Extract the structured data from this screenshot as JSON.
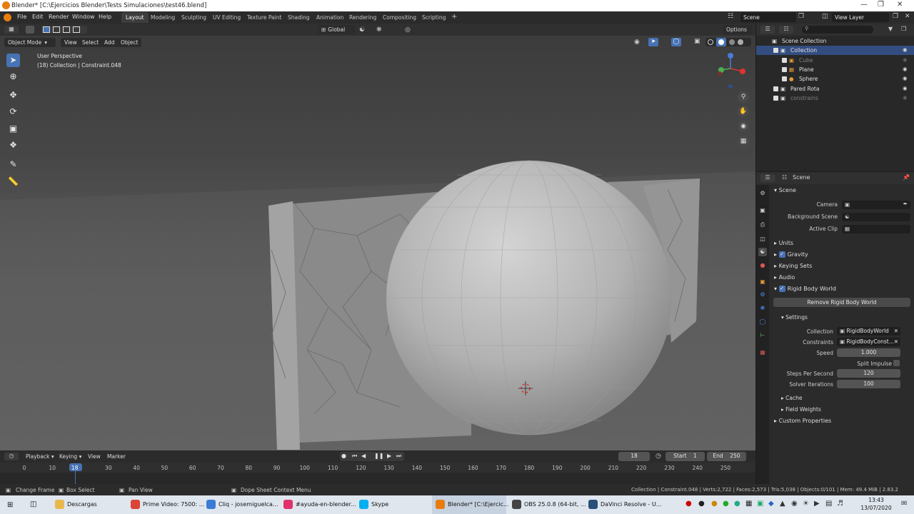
{
  "window": {
    "title": "Blender* [C:\\Ejercicios Blender\\Tests Simulaciones\\test46.blend]"
  },
  "menu": [
    "File",
    "Edit",
    "Render",
    "Window",
    "Help"
  ],
  "workspaces": [
    "Layout",
    "Modeling",
    "Sculpting",
    "UV Editing",
    "Texture Paint",
    "Shading",
    "Animation",
    "Rendering",
    "Compositing",
    "Scripting"
  ],
  "active_workspace": "Layout",
  "topbar": {
    "scene": "Scene",
    "view_layer": "View Layer",
    "options": "Options",
    "orientation": "Global"
  },
  "viewport": {
    "mode": "Object Mode",
    "menus": [
      "View",
      "Select",
      "Add",
      "Object"
    ],
    "perspective": "User Perspective",
    "info": "(18) Collection | Constraint.048"
  },
  "outliner": {
    "rows": [
      {
        "label": "Scene Collection",
        "indent": 0
      },
      {
        "label": "Collection",
        "indent": 1,
        "selected": true
      },
      {
        "label": "Cube",
        "indent": 2,
        "dim": true
      },
      {
        "label": "Plane",
        "indent": 2
      },
      {
        "label": "Sphere",
        "indent": 2
      },
      {
        "label": "Pared Rota",
        "indent": 1
      },
      {
        "label": "constrains",
        "indent": 1,
        "dim": true
      }
    ]
  },
  "properties": {
    "context": "Scene",
    "panel": "Scene",
    "camera_label": "Camera",
    "background_label": "Background Scene",
    "active_clip_label": "Active Clip",
    "sections": {
      "units": "Units",
      "gravity": "Gravity",
      "keying": "Keying Sets",
      "audio": "Audio",
      "rbw": "Rigid Body World",
      "custom": "Custom Properties"
    },
    "remove_button": "Remove Rigid Body World",
    "settings": "Settings",
    "collection_label": "Collection",
    "collection_value": "RigidBodyWorld",
    "constraints_label": "Constraints",
    "constraints_value": "RigidBodyConst...",
    "speed_label": "Speed",
    "speed_value": "1.000",
    "split_label": "Split Impulse",
    "steps_label": "Steps Per Second",
    "steps_value": "120",
    "iter_label": "Solver Iterations",
    "iter_value": "100",
    "cache": "Cache",
    "field_weights": "Field Weights"
  },
  "timeline": {
    "menus": [
      "Playback",
      "Keying",
      "View",
      "Marker"
    ],
    "current_frame": "18",
    "start_label": "Start",
    "start": "1",
    "end_label": "End",
    "end": "250",
    "ticks": [
      "0",
      "10",
      "18",
      "30",
      "40",
      "50",
      "60",
      "70",
      "80",
      "90",
      "100",
      "110",
      "120",
      "130",
      "140",
      "150",
      "160",
      "170",
      "180",
      "190",
      "200",
      "210",
      "220",
      "230",
      "240",
      "250"
    ]
  },
  "statusbar": {
    "change_frame": "Change Frame",
    "box_select": "Box Select",
    "pan_view": "Pan View",
    "context_menu": "Dope Sheet Context Menu",
    "stats": "Collection | Constraint.048 | Verts:2,722 | Faces:2,573 | Tris:5,038 | Objects:0/101 | Mem: 49.4 MiB | 2.83.2"
  },
  "taskbar": {
    "items": [
      "Descargas",
      "Prime Video: 7500: ...",
      "Cliq - josemiguelca...",
      "#ayuda-en-blender...",
      "Skype",
      "Blender* [C:\\Ejercic...",
      "OBS 25.0.8 (64-bit, ...",
      "DaVinci Resolve - U..."
    ],
    "time": "13:43",
    "date": "13/07/2020"
  }
}
